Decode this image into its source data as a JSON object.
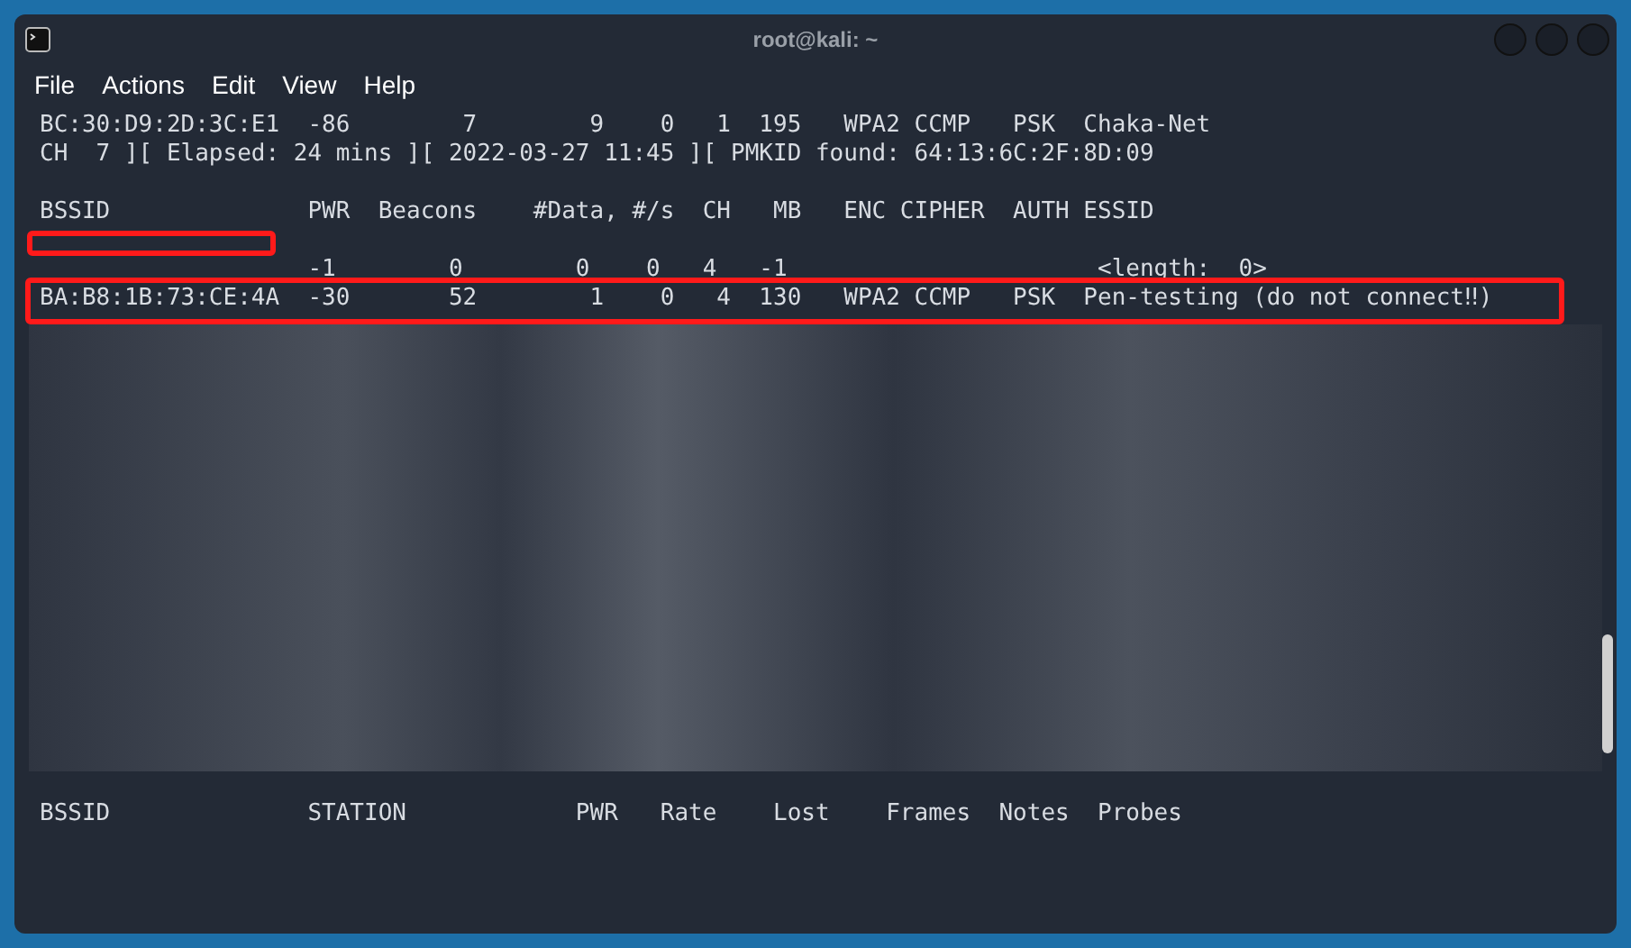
{
  "window": {
    "title": "root@kali: ~"
  },
  "menu": [
    "File",
    "Actions",
    "Edit",
    "View",
    "Help"
  ],
  "lines": [
    {
      "kind": "text",
      "text": "BC:30:D9:2D:3C:E1  -86        7        9    0   1  195   WPA2 CCMP   PSK  Chaka-Net",
      "row_highlighted": false,
      "bssid_highlighted": false
    },
    {
      "kind": "text",
      "text": "CH  7 ][ Elapsed: 24 mins ][ 2022-03-27 11:45 ][ PMKID found: 64:13:6C:2F:8D:09",
      "row_highlighted": false,
      "bssid_highlighted": false
    },
    {
      "kind": "blank"
    },
    {
      "kind": "text",
      "text": "BSSID              PWR  Beacons    #Data, #/s  CH   MB   ENC CIPHER  AUTH ESSID",
      "row_highlighted": false,
      "bssid_highlighted": false
    },
    {
      "kind": "blank"
    },
    {
      "kind": "text",
      "text": "                   -1        0        0    0   4   -1                      <length:  0>",
      "row_highlighted": false,
      "bssid_highlighted": true
    },
    {
      "kind": "text",
      "text": "BA:B8:1B:73:CE:4A  -30       52        1    0   4  130   WPA2 CCMP   PSK  Pen-testing (do not connect‼)",
      "row_highlighted": true,
      "bssid_highlighted": false
    },
    {
      "kind": "pixelated"
    },
    {
      "kind": "blank"
    },
    {
      "kind": "text",
      "text": "BSSID              STATION            PWR   Rate    Lost    Frames  Notes  Probes",
      "row_highlighted": false,
      "bssid_highlighted": false
    }
  ]
}
